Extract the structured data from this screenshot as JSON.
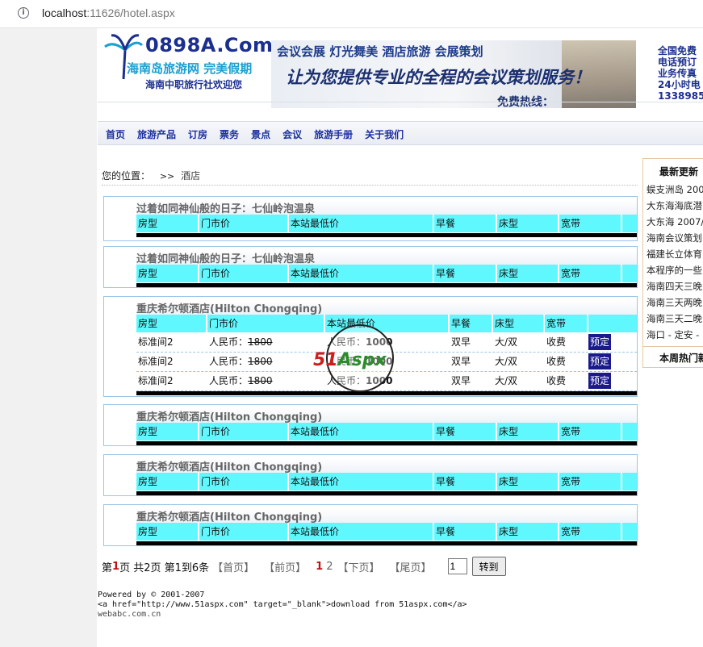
{
  "browser": {
    "url_host": "localhost",
    "url_rest": ":11626/hotel.aspx"
  },
  "header": {
    "logo_text": "0898A.Com",
    "logo_sub": "海南岛旅游网  完美假期",
    "logo_sub2": "海南中职旅行社欢迎您",
    "banner_top": "会议会展  灯光舞美  酒店旅游  会展策划",
    "banner_slogan": "让为您提供专业的全程的会议策划服务！",
    "banner_hotline": "免费热线：",
    "contact": [
      "全国免费",
      "电话预订",
      "业务传真",
      "24小时电",
      "1338985"
    ]
  },
  "nav": [
    "首页",
    "旅游产品",
    "订房",
    "票务",
    "景点",
    "会议",
    "旅游手册",
    "关于我们"
  ],
  "breadcrumb": {
    "label": "您的位置：",
    "sep": ">>",
    "current": "酒店"
  },
  "columns": [
    "房型",
    "门市价",
    "本站最低价",
    "早餐",
    "床型",
    "宽带"
  ],
  "hotels": [
    {
      "name": "过着如同神仙般的日子：七仙岭泡温泉"
    },
    {
      "name": "过着如同神仙般的日子：七仙岭泡温泉"
    },
    {
      "name": "重庆希尔顿酒店(Hilton Chongqing)",
      "rooms": [
        {
          "type": "标准间2",
          "price_prefix": "人民币：",
          "list_price": "1800",
          "low_prefix": "人民币：",
          "low_price": "1000",
          "breakfast": "双早",
          "bed": "大/双",
          "broadband": "收费",
          "book": "预定"
        },
        {
          "type": "标准间2",
          "price_prefix": "人民币：",
          "list_price": "1800",
          "low_prefix": "人民币：",
          "low_price": "1000",
          "breakfast": "双早",
          "bed": "大/双",
          "broadband": "收费",
          "book": "预定"
        },
        {
          "type": "标准间2",
          "price_prefix": "人民币：",
          "list_price": "1800",
          "low_prefix": "人民币：",
          "low_price": "1000",
          "breakfast": "双早",
          "bed": "大/双",
          "broadband": "收费",
          "book": "预定"
        }
      ]
    },
    {
      "name": "重庆希尔顿酒店(Hilton Chongqing)"
    },
    {
      "name": "重庆希尔顿酒店(Hilton Chongqing)"
    },
    {
      "name": "重庆希尔顿酒店(Hilton Chongqing)"
    }
  ],
  "watermark": {
    "a": "51",
    "b": "Aspx"
  },
  "pager": {
    "summary_a": "第",
    "current": "1",
    "summary_b": "页 共2页 第1到6条",
    "first": "【首页】",
    "prev": "【前页】",
    "page1": "1",
    "page2": "2",
    "next": "【下页】",
    "last": "【尾页】",
    "input_value": "1",
    "go": "转到"
  },
  "footer": [
    "Powered by © 2001-2007",
    "<a href=\"http://www.51aspx.com\" target=\"_blank\">download from 51aspx.com</a>",
    "webabc.com.cn"
  ],
  "sidebar": {
    "latest_title": "最新更新",
    "latest": [
      "蜈支洲岛 200",
      "大东海海底潜",
      "大东海 2007/",
      "海南会议策划",
      "福建长立体育",
      "本程序的一些",
      "海南四天三晚",
      "海南三天两晚",
      "海南三天二晚",
      "海口 - 定安 -"
    ],
    "hot_title": "本周热门新"
  }
}
